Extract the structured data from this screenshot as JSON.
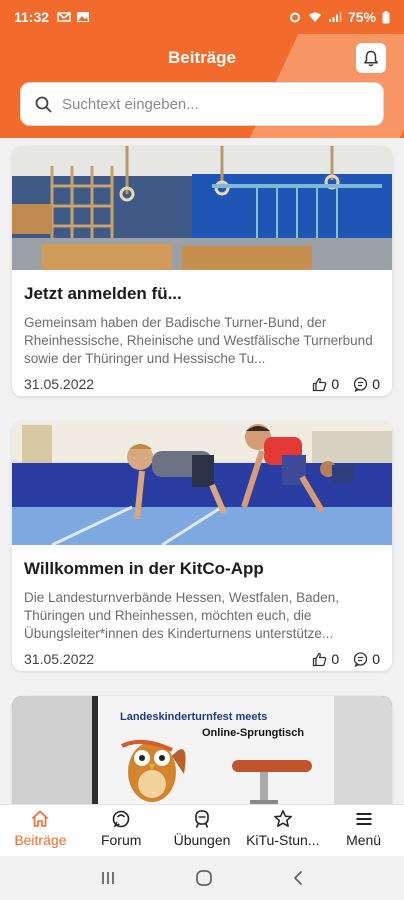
{
  "status": {
    "time": "11:32",
    "battery": "75%"
  },
  "header": {
    "title": "Beiträge",
    "accent": "#f26b2d"
  },
  "search": {
    "placeholder": "Suchtext eingeben..."
  },
  "posts": [
    {
      "title": "Jetzt anmelden fü...",
      "excerpt": "Gemeinsam haben der Badische Turner-Bund, der Rheinhessische, Rheinische und Westfälische Turnerbund sowie der Thüringer und Hessische Tu...",
      "date": "31.05.2022",
      "likes": "0",
      "comments": "0",
      "image_icon": "gym-equipment-photo"
    },
    {
      "title": "Willkommen in der KitCo-App",
      "excerpt": "Die Landesturnverbände Hessen, Westfalen, Baden, Thüringen und Rheinhessen, möchten euch, die Übungsleiter*innen des Kinderturnens unterstütze...",
      "date": "31.05.2022",
      "likes": "0",
      "comments": "0",
      "image_icon": "children-crawling-photo"
    },
    {
      "image_line1": "Landeskinderturnfest meets",
      "image_line2": "Online-Sprungtisch",
      "image_icon": "owl-illustration"
    }
  ],
  "bottom_nav": [
    {
      "label": "Beiträge",
      "icon": "home-icon",
      "active": true
    },
    {
      "label": "Forum",
      "icon": "chat-icon",
      "active": false
    },
    {
      "label": "Übungen",
      "icon": "exercise-icon",
      "active": false
    },
    {
      "label": "KiTu-Stun...",
      "icon": "star-icon",
      "active": false
    },
    {
      "label": "Menü",
      "icon": "menu-icon",
      "active": false
    }
  ]
}
